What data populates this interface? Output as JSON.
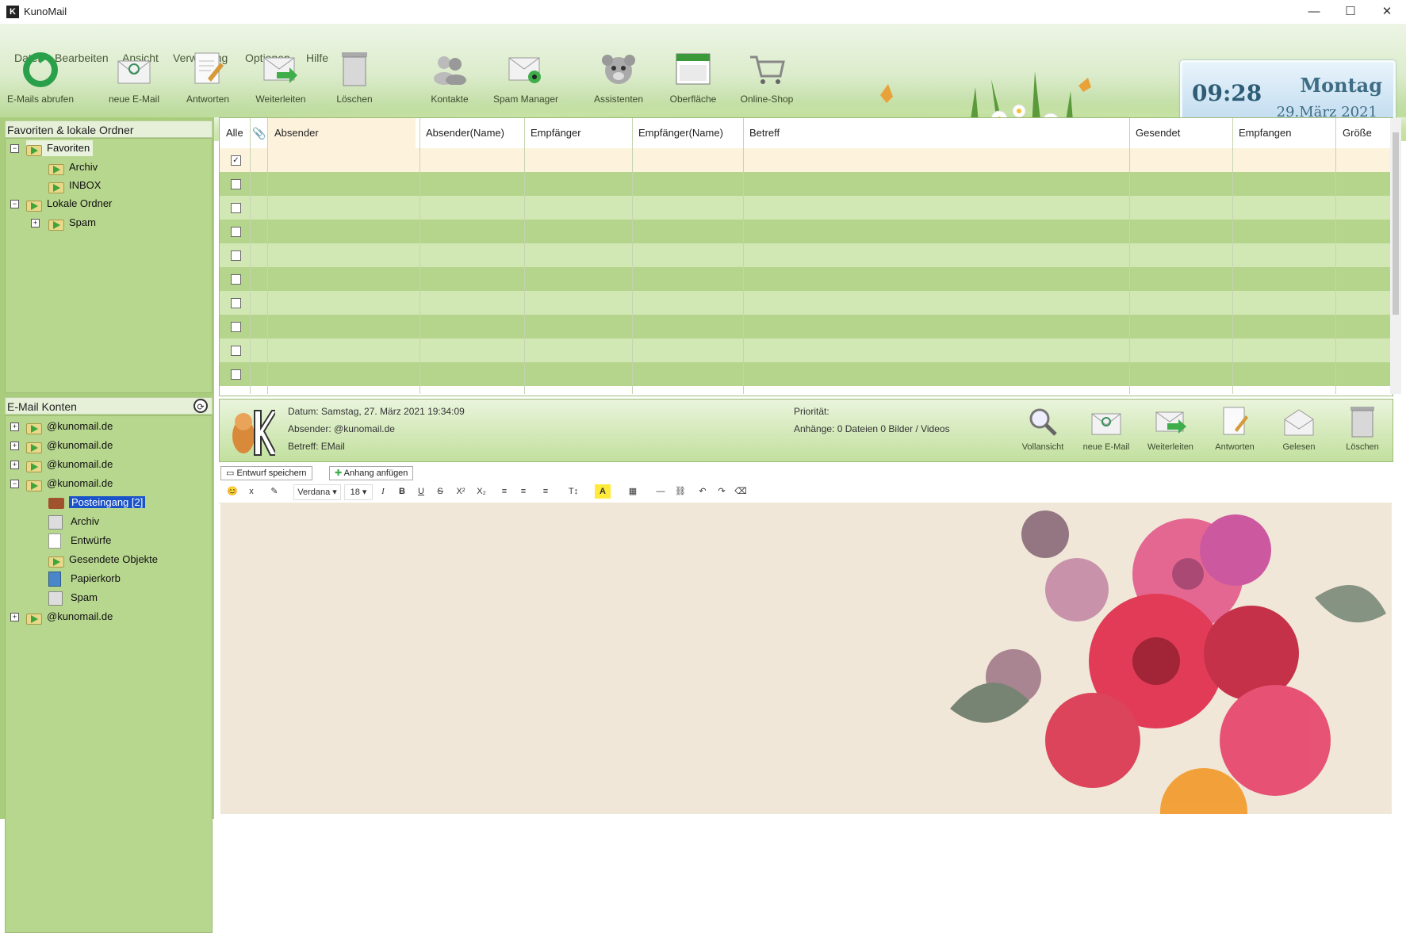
{
  "window": {
    "app_title": "KunoMail",
    "logo_letter": "K",
    "minimize": "—",
    "maximize": "☐",
    "close": "✕"
  },
  "menu": [
    "Datei",
    "Bearbeiten",
    "Ansicht",
    "Verwaltung",
    "Optionen",
    "Hilfe"
  ],
  "toolbar": [
    {
      "label": "E-Mails abrufen",
      "icon": "refresh-icon"
    },
    {
      "label": "neue E-Mail",
      "icon": "new-mail-icon"
    },
    {
      "label": "Antworten",
      "icon": "reply-icon"
    },
    {
      "label": "Weiterleiten",
      "icon": "forward-icon"
    },
    {
      "label": "Löschen",
      "icon": "trash-icon"
    },
    {
      "label": "Kontakte",
      "icon": "contacts-icon"
    },
    {
      "label": "Spam Manager",
      "icon": "spam-icon"
    },
    {
      "label": "Assistenten",
      "icon": "assistant-icon"
    },
    {
      "label": "Oberfläche",
      "icon": "theme-icon"
    },
    {
      "label": "Online-Shop",
      "icon": "cart-icon"
    }
  ],
  "clock": {
    "time": "09:28",
    "day": "Montag",
    "date": "29.März 2021"
  },
  "favorites": {
    "title": "Favoriten & lokale Ordner",
    "items": {
      "favoriten": "Favoriten",
      "archiv": "Archiv",
      "inbox": "INBOX",
      "lokale": "Lokale Ordner",
      "spam": "Spam"
    }
  },
  "accounts": {
    "title": "E-Mail Konten",
    "acc1": "@kunomail.de",
    "acc2": "@kunomail.de",
    "acc3": "@kunomail.de",
    "acc4": "@kunomail.de",
    "acc5": "@kunomail.de",
    "sub": {
      "posteingang": "Posteingang [2]",
      "archiv": "Archiv",
      "entwuerfe": "Entwürfe",
      "gesendet": "Gesendete Objekte",
      "papierkorb": "Papierkorb",
      "spam": "Spam"
    }
  },
  "list": {
    "columns": {
      "alle": "Alle",
      "absender": "Absender",
      "absender_name": "Absender(Name)",
      "empfaenger": "Empfänger",
      "empfaenger_name": "Empfänger(Name)",
      "betreff": "Betreff",
      "gesendet": "Gesendet",
      "empfangen": "Empfangen",
      "groesse": "Größe"
    },
    "row_count": 10,
    "first_row_checked": true
  },
  "preview": {
    "datum": "Datum: Samstag, 27. März 2021 19:34:09",
    "absender": "Absender: @kunomail.de",
    "betreff": "Betreff: EMail",
    "prioritaet": "Priorität:",
    "anhaenge": "Anhänge: 0 Dateien 0 Bilder / Videos",
    "buttons": [
      {
        "label": "Vollansicht",
        "icon": "magnifier-icon"
      },
      {
        "label": "neue E-Mail",
        "icon": "new-mail-icon"
      },
      {
        "label": "Weiterleiten",
        "icon": "forward-icon"
      },
      {
        "label": "Antworten",
        "icon": "reply-icon"
      },
      {
        "label": "Gelesen",
        "icon": "read-icon"
      },
      {
        "label": "Löschen",
        "icon": "trash-icon"
      }
    ]
  },
  "editor": {
    "tab_save": "Entwurf speichern",
    "tab_attach": "Anhang anfügen",
    "font": "Verdana",
    "size": "18",
    "buttons": {
      "emoji": "😊",
      "x": "x",
      "wand": "✎",
      "italic": "I",
      "bold": "B",
      "underline": "U",
      "strike": "S",
      "sup": "X²",
      "sub": "X₂",
      "ol": "≡",
      "ul": "≡",
      "align": "≡",
      "textsize": "T↕",
      "color": "A",
      "table": "▦",
      "hr": "—",
      "link": "⛓",
      "undo": "↶",
      "redo": "↷",
      "clear": "⌫"
    }
  }
}
